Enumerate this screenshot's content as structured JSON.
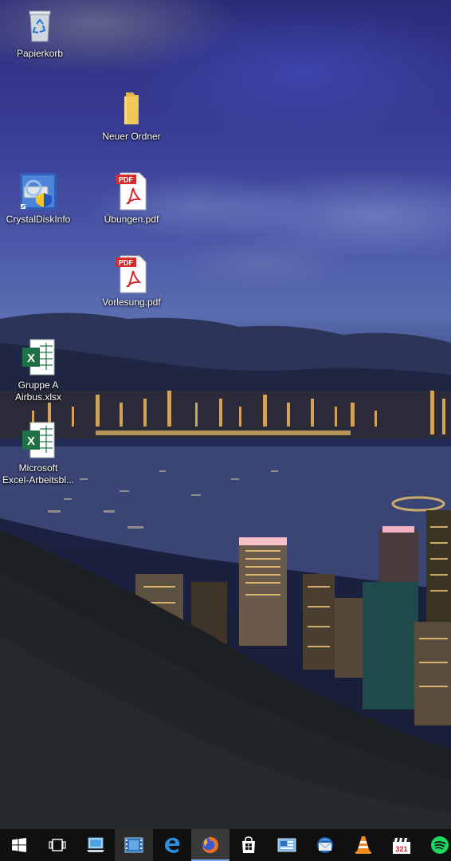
{
  "desktop": {
    "icons": [
      {
        "label": "Papierkorb",
        "icon": "recycle-bin-icon"
      },
      {
        "label": "Neuer Ordner",
        "icon": "folder-icon"
      },
      {
        "label": "CrystalDiskInfo",
        "icon": "crystaldiskinfo-icon"
      },
      {
        "label": "Übungen.pdf",
        "icon": "pdf-icon"
      },
      {
        "label": "Vorlesung.pdf",
        "icon": "pdf-icon"
      },
      {
        "label": "Gruppe A Airbus.xlsx",
        "icon": "excel-icon"
      },
      {
        "label": "Microsoft\nExcel-Arbeitsbl...",
        "icon": "excel-icon"
      }
    ],
    "pdf_badge": "PDF",
    "excel_badge": "X",
    "counter_badge": "321"
  },
  "taskbar": {
    "buttons": [
      {
        "name": "start",
        "icon": "windows-start-icon"
      },
      {
        "name": "task-view",
        "icon": "task-view-icon"
      },
      {
        "name": "this-pc",
        "icon": "computer-icon"
      },
      {
        "name": "video",
        "icon": "film-icon"
      },
      {
        "name": "edge",
        "icon": "edge-icon"
      },
      {
        "name": "firefox",
        "icon": "firefox-icon",
        "state": "active"
      },
      {
        "name": "store",
        "icon": "store-icon"
      },
      {
        "name": "control-panel",
        "icon": "control-panel-icon"
      },
      {
        "name": "thunderbird",
        "icon": "thunderbird-icon"
      },
      {
        "name": "vlc",
        "icon": "vlc-icon"
      },
      {
        "name": "media-player",
        "icon": "clapper-icon"
      },
      {
        "name": "spotify",
        "icon": "spotify-icon"
      }
    ]
  },
  "colors": {
    "taskbar_bg": "#101010",
    "accent": "#7aa9e6",
    "pdf_red": "#d42b2b",
    "excel_green": "#1e7145",
    "folder_yellow": "#f3c85b"
  }
}
